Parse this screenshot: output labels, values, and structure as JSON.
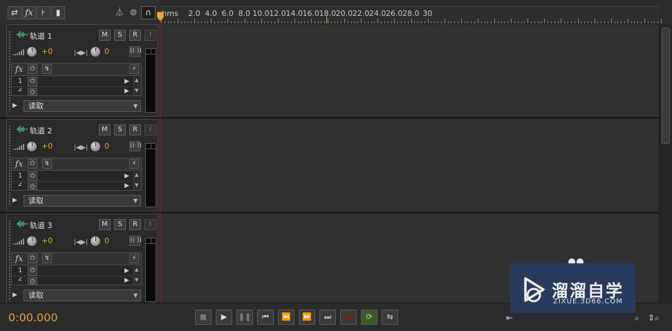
{
  "ruler": {
    "unit": "hms",
    "labels": [
      "2.0",
      "4.0",
      "6.0",
      "8.0",
      "10.0",
      "12.0",
      "14.0",
      "16.0",
      "18.0",
      "20.0",
      "22.0",
      "24.0",
      "26.0",
      "28.0",
      "30"
    ]
  },
  "toolbar": {
    "icons": [
      "switch-arrows-icon",
      "fx-icon",
      "send-icon",
      "eq-icon",
      "metronome-icon",
      "punch-icon",
      "headphones-icon"
    ],
    "fx_label": "fx"
  },
  "tracks": [
    {
      "name": "轨道 1",
      "mute": "M",
      "solo": "S",
      "record": "R",
      "input": "I",
      "volume": "+0",
      "pan": "0",
      "fx_label": "fx",
      "slots": [
        "1",
        "2"
      ],
      "read_mode": "读取"
    },
    {
      "name": "轨道 2",
      "mute": "M",
      "solo": "S",
      "record": "R",
      "input": "I",
      "volume": "+0",
      "pan": "0",
      "fx_label": "fx",
      "slots": [
        "1",
        "2"
      ],
      "read_mode": "读取"
    },
    {
      "name": "轨道 3",
      "mute": "M",
      "solo": "S",
      "record": "R",
      "input": "I",
      "volume": "+0",
      "pan": "0",
      "fx_label": "fx",
      "slots": [
        "1",
        "2"
      ],
      "read_mode": "读取"
    }
  ],
  "transport": {
    "timecode": "0:00.000",
    "buttons": [
      "stop",
      "play",
      "pause",
      "go-to-start",
      "rewind",
      "fast-forward",
      "go-to-end",
      "record",
      "loop",
      "skip"
    ]
  },
  "colors": {
    "accent": "#e0a334",
    "playhead": "#a01818",
    "wave": "#4fd08c"
  },
  "watermark": {
    "title": "溜溜自学",
    "subtitle": "ZIXUE.3D66.COM"
  }
}
